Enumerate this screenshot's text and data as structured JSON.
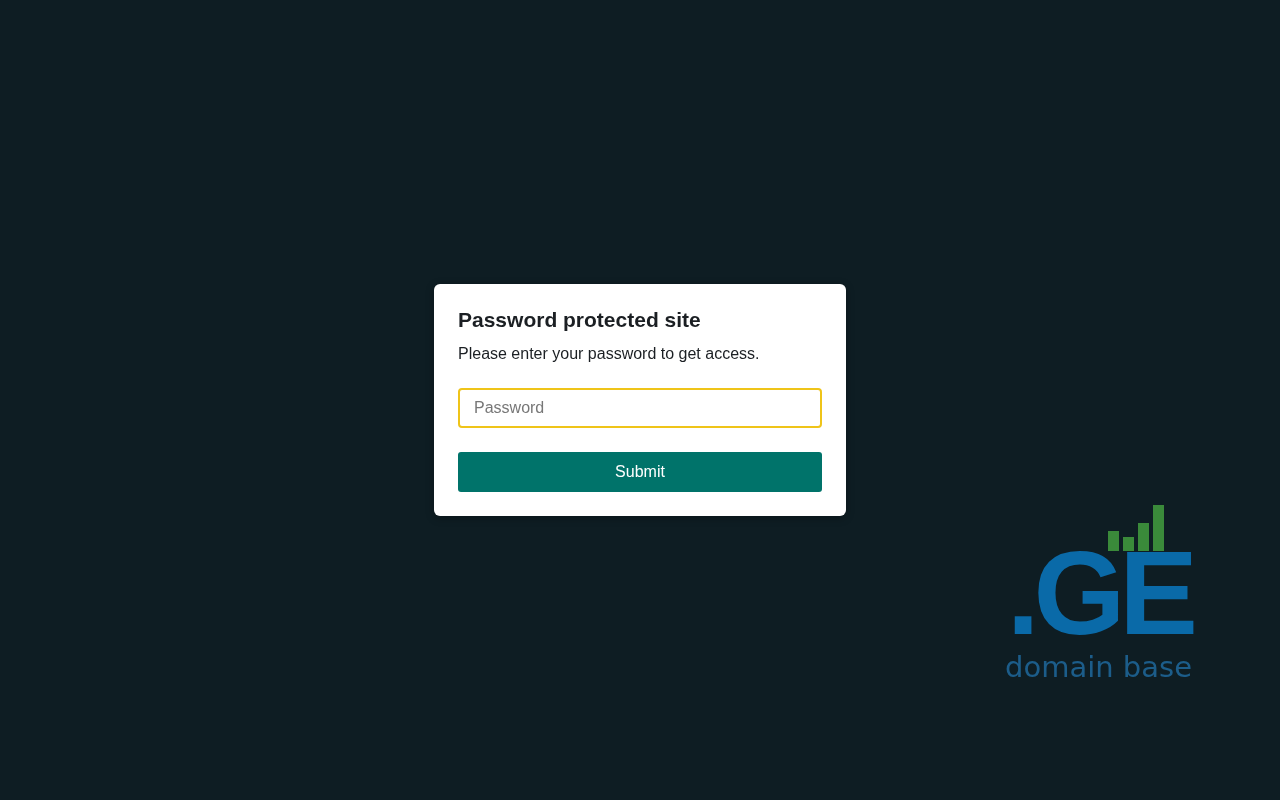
{
  "dialog": {
    "title": "Password protected site",
    "message": "Please enter your password to get access.",
    "password_field": {
      "placeholder": "Password",
      "focused": true
    },
    "submit_button": {
      "label": "Submit"
    }
  },
  "logo": {
    "mark": ".GE",
    "tagline": "domain base"
  }
}
